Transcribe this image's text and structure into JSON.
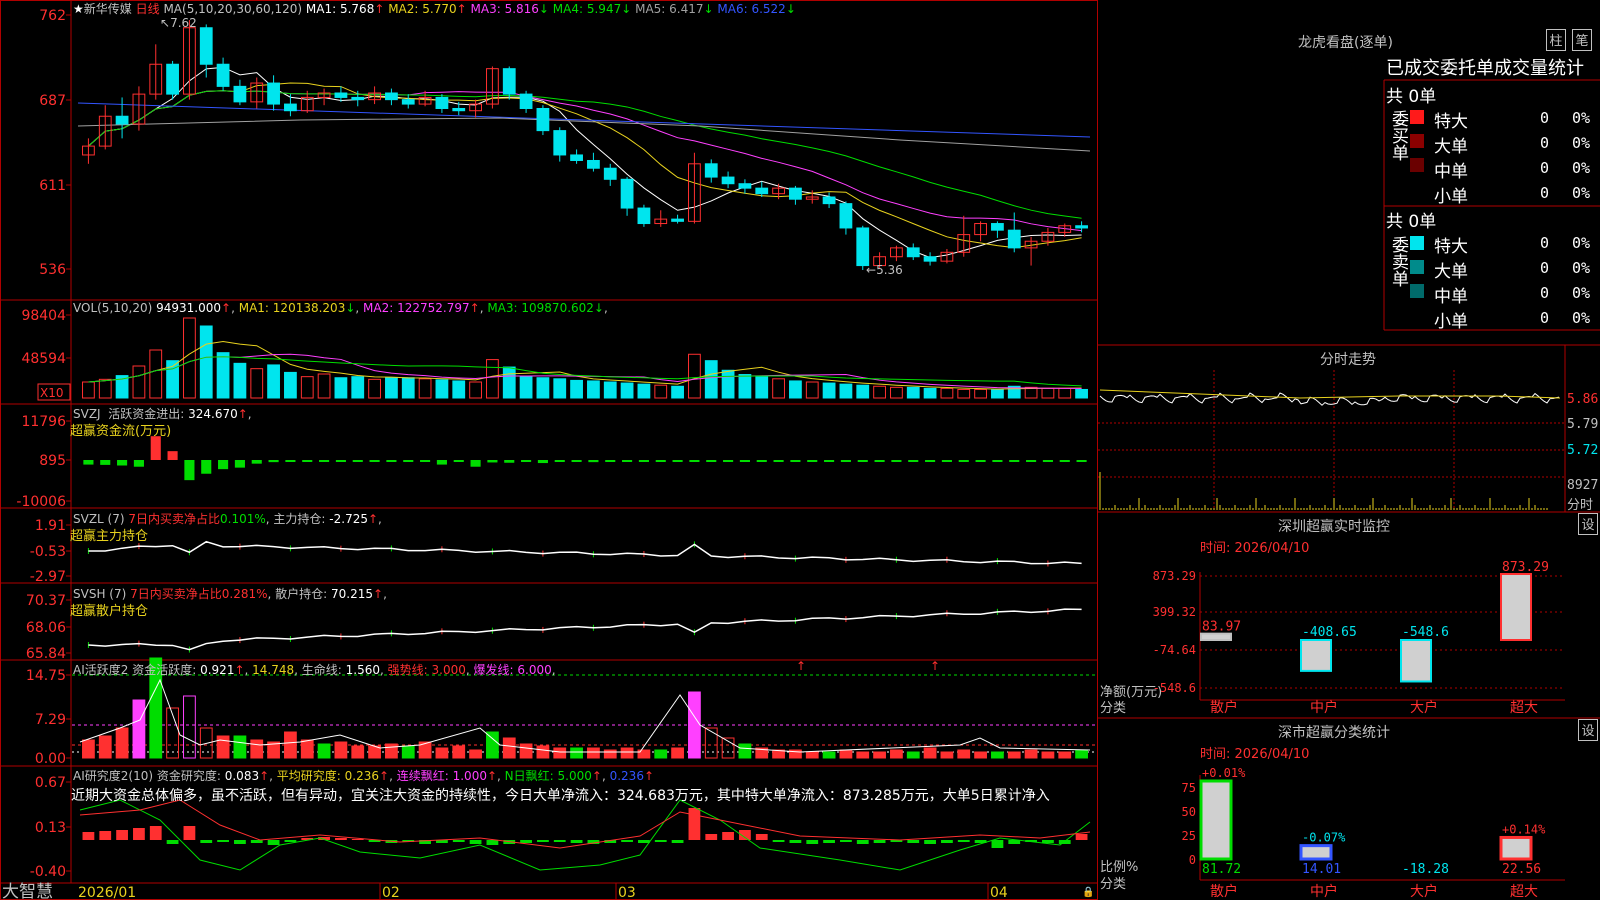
{
  "colors": {
    "red": "#ff3030",
    "cyan": "#00e5ee",
    "white": "#ffffff",
    "yellow": "#e8d21e",
    "magenta": "#ff40ff",
    "green": "#00dd00",
    "blue": "#3355ff",
    "gray": "#a0a0a0",
    "frame": "#b00000"
  },
  "stock": {
    "name": "新华传媒",
    "period": "日线",
    "star_icon": "star-icon"
  },
  "price_panel": {
    "ma_header": "MA(5,10,20,30,60,120)",
    "ma": [
      {
        "label": "MA1:",
        "value": "5.768",
        "arrow": "↑",
        "color": "#ffffff"
      },
      {
        "label": "MA2:",
        "value": "5.770",
        "arrow": "↑",
        "color": "#e8d21e"
      },
      {
        "label": "MA3:",
        "value": "5.816",
        "arrow": "↓",
        "color": "#ff40ff"
      },
      {
        "label": "MA4:",
        "value": "5.947",
        "arrow": "↓",
        "color": "#00dd00"
      },
      {
        "label": "MA5:",
        "value": "6.417",
        "arrow": "↓",
        "color": "#a0a0a0"
      },
      {
        "label": "MA6:",
        "value": "6.522",
        "arrow": "↓",
        "color": "#3355ff"
      }
    ],
    "y_labels": [
      "762",
      "687",
      "611",
      "536"
    ],
    "high_mark": "7.62",
    "low_mark": "5.36"
  },
  "vol_panel": {
    "header": "VOL(5,10,20)",
    "value": "94931.000",
    "arrow": "↑",
    "ma": [
      {
        "label": "MA1:",
        "value": "120138.203",
        "arrow": "↓",
        "color": "#e8d21e"
      },
      {
        "label": "MA2:",
        "value": "122752.797",
        "arrow": "↑",
        "color": "#ff40ff"
      },
      {
        "label": "MA3:",
        "value": "109870.602",
        "arrow": "↓",
        "color": "#00dd00"
      }
    ],
    "y_labels": [
      "98404",
      "48594"
    ],
    "unit": "X10"
  },
  "svzj_panel": {
    "header": "SVZJ",
    "label": "活跃资金进出:",
    "value": "324.670",
    "arrow": "↑",
    "subtitle": "超赢资金流(万元)",
    "y_labels": [
      "11796",
      "895",
      "-10006"
    ]
  },
  "svzl_panel": {
    "header": "SVZL (7)",
    "ratio_label": "7日内买卖净占比",
    "ratio_value": "0.101%",
    "label": "主力持仓:",
    "value": "-2.725",
    "arrow": "↑",
    "subtitle": "超赢主力持仓",
    "y_labels": [
      "1.91",
      "-0.53",
      "-2.97"
    ]
  },
  "svsh_panel": {
    "header": "SVSH (7)",
    "ratio_label": "7日内买卖净占比",
    "ratio_value": "0.281%",
    "label": "散户持仓:",
    "value": "70.215",
    "arrow": "↑",
    "subtitle": "超赢散户持仓",
    "y_labels": [
      "70.37",
      "68.06",
      "65.84"
    ]
  },
  "ai_active_panel": {
    "header": "AI活跃度2",
    "label": "资金活跃度:",
    "value": "0.921",
    "arrow": "↑",
    "v2": "14.748",
    "label3": "生命线:",
    "v3": "1.560",
    "label4": "强势线:",
    "v4": "3.000",
    "label5": "爆发线:",
    "v5": "6.000",
    "y_labels": [
      "14.75",
      "7.29",
      "0.00"
    ]
  },
  "ai_research_panel": {
    "header": "AI研究度2(10)",
    "label": "资金研究度:",
    "value": "0.083",
    "arrow": "↑",
    "label2": "平均研究度:",
    "v2": "0.236",
    "label3": "连续飘红:",
    "v3": "1.000",
    "label4": "N日飘红:",
    "v4": "5.000",
    "v5": "0.236",
    "comment": "近期大资金总体偏多，虽不活跃，但有异动，宜关注大资金的持续性，今日大单净流入：324.683万元，其中特大单净流入：873.285万元，大单5日累计净入",
    "y_labels": [
      "0.67",
      "0.13",
      "-0.40"
    ]
  },
  "bottom_bar": {
    "brand": "大智慧",
    "dates": [
      "2026/01",
      "02",
      "03",
      "04"
    ]
  },
  "lhb": {
    "title": "龙虎看盘(逐单)",
    "btn_zhu": "柱",
    "btn_bi": "笔",
    "subtitle": "已成交委托单成交量统计",
    "buy": {
      "side": "委买单",
      "total": "共 0单",
      "rows": [
        {
          "name": "特大",
          "qty": "0",
          "pct": "0%"
        },
        {
          "name": "大单",
          "qty": "0",
          "pct": "0%"
        },
        {
          "name": "中单",
          "qty": "0",
          "pct": "0%"
        },
        {
          "name": "小单",
          "qty": "0",
          "pct": "0%"
        }
      ]
    },
    "sell": {
      "side": "委卖单",
      "total": "共 0单",
      "rows": [
        {
          "name": "特大",
          "qty": "0",
          "pct": "0%"
        },
        {
          "name": "大单",
          "qty": "0",
          "pct": "0%"
        },
        {
          "name": "中单",
          "qty": "0",
          "pct": "0%"
        },
        {
          "name": "小单",
          "qty": "0",
          "pct": "0%"
        }
      ]
    }
  },
  "intraday": {
    "title": "分时走势",
    "y_labels": [
      "5.86",
      "5.79",
      "5.72"
    ],
    "vol_label": "8927",
    "footer": "分时"
  },
  "monitor": {
    "title": "深圳超赢实时监控",
    "btn": "设",
    "date": "时间: 2026/04/10",
    "y_labels": [
      "873.29",
      "399.32",
      "-74.64",
      "-548.6"
    ],
    "axis_title": "净额(万元)",
    "axis_cat": "分类",
    "cats": [
      "散户",
      "中户",
      "大户",
      "超大"
    ],
    "values": [
      "83.97",
      "-408.65",
      "-548.6",
      "873.29"
    ]
  },
  "classify": {
    "title": "深市超赢分类统计",
    "btn": "设",
    "date": "时间: 2026/04/10",
    "y_labels": [
      "75",
      "50",
      "25",
      "0"
    ],
    "axis_title": "比例%",
    "axis_cat": "分类",
    "cats": [
      "散户",
      "中户",
      "大户",
      "超大"
    ],
    "values": [
      "81.72",
      "14.01",
      "-18.28",
      "22.56"
    ],
    "changes": [
      "+0.01%",
      "-0.07%",
      "",
      "+0.14%"
    ]
  },
  "chart_data": [
    {
      "type": "candlestick",
      "title": "新华传媒 日线",
      "series": [
        {
          "name": "MA1"
        },
        {
          "name": "MA2"
        },
        {
          "name": "MA3"
        },
        {
          "name": "MA4"
        },
        {
          "name": "MA5"
        },
        {
          "name": "MA6"
        }
      ],
      "ylim": [
        5.3,
        7.65
      ],
      "candles": [
        [
          6.4,
          6.48,
          6.32,
          6.55
        ],
        [
          6.48,
          6.75,
          6.45,
          6.85
        ],
        [
          6.75,
          6.68,
          6.55,
          6.92
        ],
        [
          6.68,
          6.95,
          6.62,
          7.02
        ],
        [
          6.95,
          7.22,
          6.9,
          7.4
        ],
        [
          7.22,
          6.95,
          6.9,
          7.25
        ],
        [
          6.95,
          7.55,
          6.9,
          7.62
        ],
        [
          7.55,
          7.22,
          7.1,
          7.58
        ],
        [
          7.22,
          7.02,
          6.98,
          7.28
        ],
        [
          7.02,
          6.88,
          6.85,
          7.08
        ],
        [
          6.88,
          7.05,
          6.82,
          7.1
        ],
        [
          7.05,
          6.86,
          6.8,
          7.12
        ],
        [
          6.86,
          6.8,
          6.75,
          6.95
        ],
        [
          6.8,
          6.92,
          6.78,
          6.98
        ],
        [
          6.92,
          6.96,
          6.85,
          7.0
        ],
        [
          6.96,
          6.92,
          6.88,
          7.02
        ],
        [
          6.92,
          6.9,
          6.84,
          6.98
        ],
        [
          6.9,
          6.96,
          6.86,
          7.02
        ],
        [
          6.96,
          6.9,
          6.85,
          7.0
        ],
        [
          6.9,
          6.86,
          6.82,
          6.95
        ],
        [
          6.86,
          6.92,
          6.84,
          6.98
        ],
        [
          6.92,
          6.82,
          6.78,
          6.95
        ],
        [
          6.82,
          6.8,
          6.76,
          6.88
        ],
        [
          6.8,
          6.86,
          6.74,
          6.9
        ],
        [
          6.86,
          7.18,
          6.82,
          7.2
        ],
        [
          7.18,
          6.95,
          6.9,
          7.2
        ],
        [
          6.95,
          6.82,
          6.78,
          6.98
        ],
        [
          6.82,
          6.62,
          6.58,
          6.85
        ],
        [
          6.62,
          6.4,
          6.34,
          6.65
        ],
        [
          6.4,
          6.35,
          6.32,
          6.45
        ],
        [
          6.35,
          6.28,
          6.25,
          6.42
        ],
        [
          6.28,
          6.18,
          6.12,
          6.32
        ],
        [
          6.18,
          5.92,
          5.85,
          6.2
        ],
        [
          5.92,
          5.78,
          5.75,
          5.95
        ],
        [
          5.78,
          5.82,
          5.75,
          5.9
        ],
        [
          5.82,
          5.8,
          5.78,
          5.86
        ],
        [
          5.8,
          6.32,
          5.78,
          6.42
        ],
        [
          6.32,
          6.2,
          6.15,
          6.36
        ],
        [
          6.2,
          6.14,
          6.1,
          6.25
        ],
        [
          6.14,
          6.1,
          6.05,
          6.18
        ],
        [
          6.1,
          6.05,
          6.02,
          6.16
        ],
        [
          6.05,
          6.1,
          6.0,
          6.14
        ],
        [
          6.1,
          6.0,
          5.95,
          6.12
        ],
        [
          6.0,
          6.02,
          5.96,
          6.08
        ],
        [
          6.02,
          5.96,
          5.92,
          6.06
        ],
        [
          5.96,
          5.74,
          5.68,
          5.98
        ],
        [
          5.74,
          5.4,
          5.36,
          5.76
        ],
        [
          5.4,
          5.48,
          5.38,
          5.52
        ],
        [
          5.48,
          5.56,
          5.44,
          5.58
        ],
        [
          5.56,
          5.48,
          5.45,
          5.6
        ],
        [
          5.48,
          5.44,
          5.4,
          5.52
        ],
        [
          5.44,
          5.52,
          5.42,
          5.55
        ],
        [
          5.52,
          5.68,
          5.48,
          5.85
        ],
        [
          5.68,
          5.78,
          5.62,
          5.8
        ],
        [
          5.78,
          5.72,
          5.65,
          5.8
        ],
        [
          5.72,
          5.56,
          5.52,
          5.88
        ],
        [
          5.56,
          5.62,
          5.4,
          5.66
        ],
        [
          5.62,
          5.7,
          5.58,
          5.74
        ],
        [
          5.7,
          5.76,
          5.66,
          5.78
        ],
        [
          5.76,
          5.74,
          5.7,
          5.8
        ]
      ]
    },
    {
      "type": "bar",
      "title": "VOL",
      "series": [
        {
          "name": "VOL"
        }
      ],
      "values": [
        30,
        35,
        42,
        60,
        90,
        70,
        150,
        135,
        85,
        65,
        55,
        62,
        48,
        40,
        45,
        38,
        40,
        35,
        38,
        38,
        36,
        34,
        32,
        30,
        72,
        58,
        40,
        38,
        36,
        33,
        32,
        30,
        28,
        26,
        24,
        22,
        82,
        70,
        52,
        44,
        40,
        36,
        32,
        30,
        28,
        26,
        24,
        22,
        20,
        20,
        18,
        18,
        16,
        16,
        15,
        22,
        20,
        18,
        18,
        16
      ]
    },
    {
      "type": "bar",
      "title": "超赢资金流(万元)",
      "values": [
        -1500,
        -1600,
        -1800,
        -2200,
        7800,
        2900,
        -6600,
        -4500,
        -3000,
        -2500,
        -1200,
        -700,
        -500,
        -600,
        -400,
        -500,
        -300,
        -400,
        -350,
        -500,
        -400,
        -1500,
        -600,
        -2200,
        -800,
        -900,
        -400,
        -1000,
        -500,
        -600,
        -700,
        -300,
        -400,
        -500,
        -300,
        -600,
        -500,
        -400,
        -500,
        -300,
        -400,
        -600,
        -300,
        -500,
        -400,
        -300,
        -600,
        -400,
        -300,
        -500,
        -400,
        -300,
        -200,
        -300,
        -200,
        -300,
        -200,
        -300,
        -200,
        -300,
        -400
      ],
      "ylim": [
        -10006,
        11796
      ]
    }
  ]
}
